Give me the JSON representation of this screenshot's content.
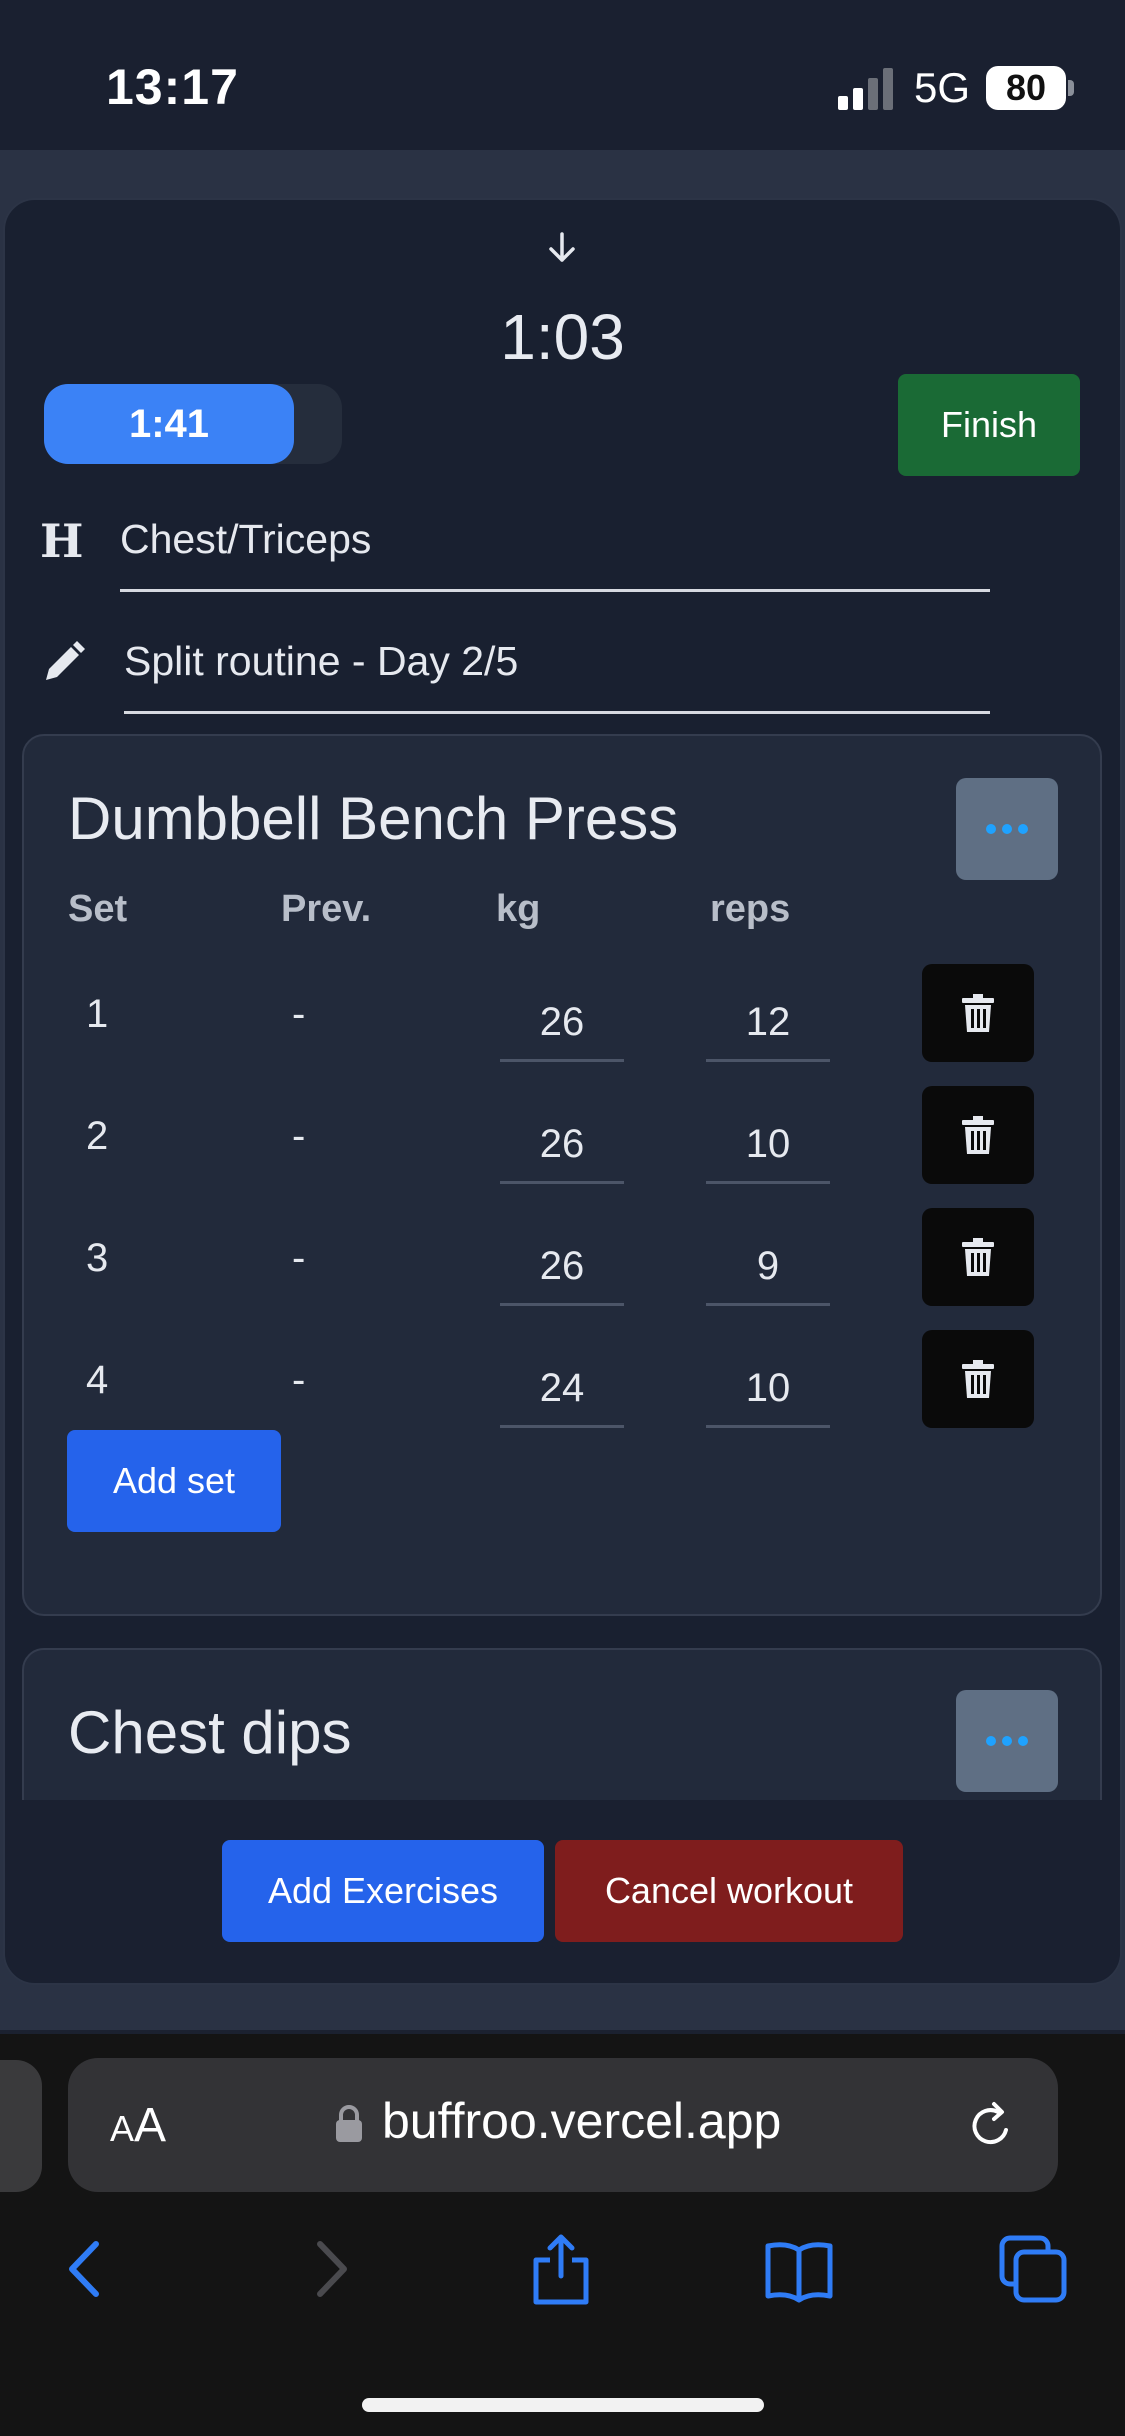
{
  "status_bar": {
    "time": "13:17",
    "network": "5G",
    "battery": "80"
  },
  "workout": {
    "elapsed": "1:03",
    "rest_timer": "1:41",
    "rest_progress": 0.84,
    "finish_label": "Finish",
    "title": "Chest/Triceps",
    "note": "Split routine - Day 2/5"
  },
  "table_headers": {
    "set": "Set",
    "prev": "Prev.",
    "weight": "kg",
    "reps": "reps"
  },
  "exercises": [
    {
      "name": "Dumbbell Bench Press",
      "sets": [
        {
          "set": "1",
          "prev": "-",
          "kg": "26",
          "reps": "12"
        },
        {
          "set": "2",
          "prev": "-",
          "kg": "26",
          "reps": "10"
        },
        {
          "set": "3",
          "prev": "-",
          "kg": "26",
          "reps": "9"
        },
        {
          "set": "4",
          "prev": "-",
          "kg": "24",
          "reps": "10"
        }
      ],
      "add_set_label": "Add set"
    },
    {
      "name": "Chest dips"
    }
  ],
  "actions": {
    "add_exercises": "Add Exercises",
    "cancel_workout": "Cancel workout"
  },
  "browser": {
    "text_size_small": "A",
    "text_size_large": "A",
    "url": "buffroo.vercel.app"
  },
  "colors": {
    "accent_blue": "#2563eb",
    "rest_blue": "#3b82f6",
    "finish_green": "#1a6a35",
    "cancel_red": "#7f1d1d",
    "safari_blue": "#2f7cf6"
  },
  "icons": [
    "down-arrow-icon",
    "heading-icon",
    "pencil-icon",
    "more-dots-icon",
    "trash-icon",
    "lock-icon",
    "reload-icon",
    "back-icon",
    "forward-icon",
    "share-icon",
    "bookmarks-icon",
    "tabs-icon"
  ]
}
